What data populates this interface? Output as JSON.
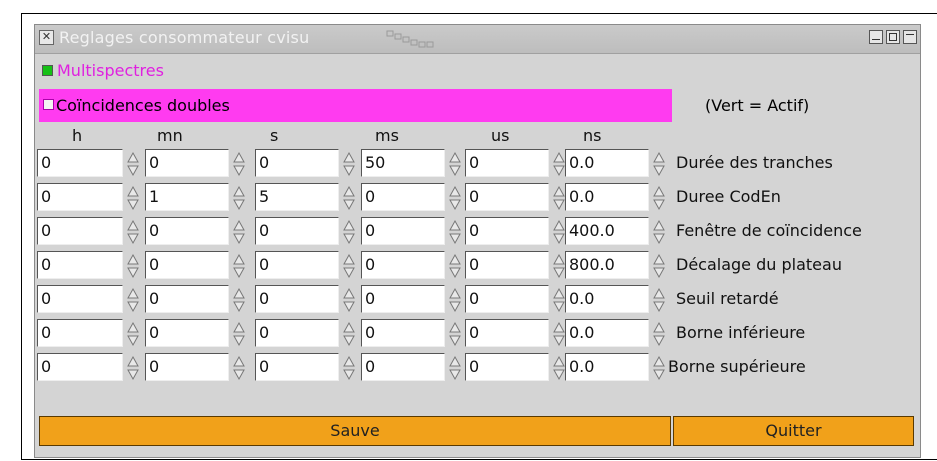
{
  "window": {
    "title": "Reglages consommateur cvisu"
  },
  "options": {
    "multispectres_label": "Multispectres",
    "coincidences_label": "Coïncidences doubles",
    "legend": "(Vert = Actif)"
  },
  "columns": [
    "h",
    "mn",
    "s",
    "ms",
    "us",
    "ns"
  ],
  "rows": [
    {
      "label": "Durée des tranches",
      "values": [
        "0",
        "0",
        "0",
        "50",
        "0",
        "0.0"
      ]
    },
    {
      "label": "Duree CodEn",
      "values": [
        "0",
        "1",
        "5",
        "0",
        "0",
        "0.0"
      ]
    },
    {
      "label": "Fenêtre de coïncidence",
      "values": [
        "0",
        "0",
        "0",
        "0",
        "0",
        "400.0"
      ]
    },
    {
      "label": "Décalage du plateau",
      "values": [
        "0",
        "0",
        "0",
        "0",
        "0",
        "800.0"
      ]
    },
    {
      "label": "Seuil retardé",
      "values": [
        "0",
        "0",
        "0",
        "0",
        "0",
        "0.0"
      ]
    },
    {
      "label": "Borne inférieure",
      "values": [
        "0",
        "0",
        "0",
        "0",
        "0",
        "0.0"
      ]
    },
    {
      "label": "Borne supérieure",
      "values": [
        "0",
        "0",
        "0",
        "0",
        "0",
        "0.0"
      ]
    }
  ],
  "buttons": {
    "save": "Sauve",
    "quit": "Quitter"
  },
  "colors": {
    "multispectres_text": "#e020e0",
    "active_green": "#16c016",
    "coincidences_bg": "#ff3bf0",
    "button_bg": "#f1a11a",
    "window_bg": "#d4d4d4"
  }
}
